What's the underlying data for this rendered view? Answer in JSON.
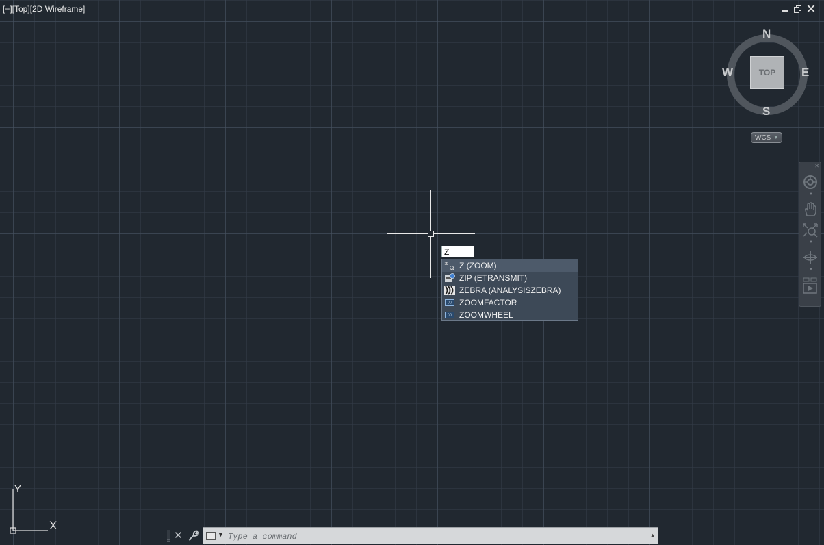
{
  "viewport": {
    "label": "[−][Top][2D Wireframe]",
    "controls": [
      "minimize",
      "restore",
      "close"
    ]
  },
  "viewcube": {
    "face": "TOP",
    "north": "N",
    "south": "S",
    "east": "E",
    "west": "W",
    "coordinate_system": "WCS"
  },
  "navbar": {
    "tools": [
      "steering-wheel",
      "pan",
      "zoom-extents",
      "orbit",
      "showmotion"
    ]
  },
  "dynamic_input": {
    "value": "Z"
  },
  "autocomplete": {
    "items": [
      {
        "label": "Z (ZOOM)",
        "icon": "zoom-icon",
        "selected": true
      },
      {
        "label": "ZIP (ETRANSMIT)",
        "icon": "etransmit-icon",
        "selected": false
      },
      {
        "label": "ZEBRA (ANALYSISZEBRA)",
        "icon": "zebra-icon",
        "selected": false
      },
      {
        "label": "ZOOMFACTOR",
        "icon": "system-variable-icon",
        "selected": false
      },
      {
        "label": "ZOOMWHEEL",
        "icon": "system-variable-icon",
        "selected": false
      }
    ]
  },
  "ucs": {
    "x_label": "X",
    "y_label": "Y"
  },
  "command_line": {
    "placeholder": "Type a command",
    "value": ""
  },
  "colors": {
    "background": "#212830",
    "grid_major": "#465260",
    "grid_minor": "#343d48",
    "autocomplete_bg": "#3d4957",
    "command_field": "#d6d8da"
  }
}
